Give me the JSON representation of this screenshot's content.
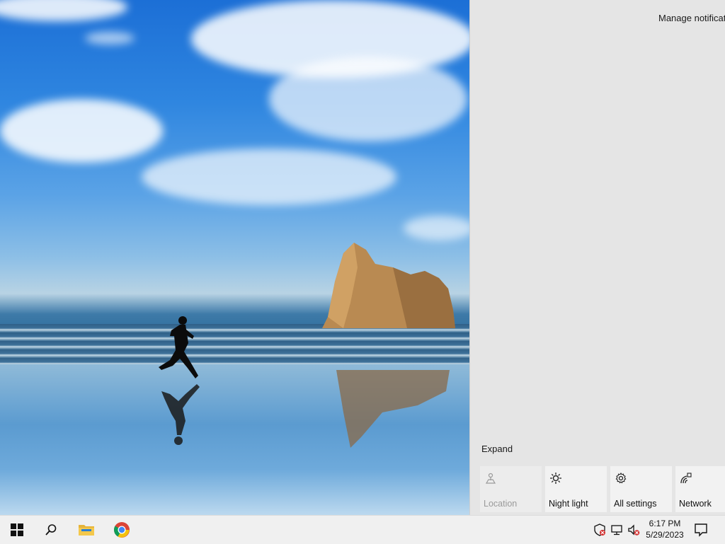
{
  "action_center": {
    "manage_notifications": "Manage notificatio",
    "expand": "Expand",
    "quick_actions": [
      {
        "label": "Location",
        "icon": "location-icon",
        "enabled": false
      },
      {
        "label": "Night light",
        "icon": "night-light-icon",
        "enabled": true
      },
      {
        "label": "All settings",
        "icon": "settings-gear-icon",
        "enabled": true
      },
      {
        "label": "Network",
        "icon": "network-icon",
        "enabled": true
      }
    ]
  },
  "taskbar": {
    "pinned": [
      {
        "name": "start-button",
        "icon": "windows-logo-icon"
      },
      {
        "name": "search-button",
        "icon": "search-icon"
      },
      {
        "name": "file-explorer-button",
        "icon": "folder-icon"
      },
      {
        "name": "chrome-button",
        "icon": "chrome-icon"
      }
    ],
    "tray": [
      "security-icon",
      "network-icon",
      "volume-muted-icon"
    ],
    "time": "6:17 PM",
    "date": "5/29/2023"
  },
  "colors": {
    "action_center_bg": "#e5e5e5",
    "tile_bg": "#f2f2f2",
    "taskbar_bg": "#f0f0f0"
  }
}
